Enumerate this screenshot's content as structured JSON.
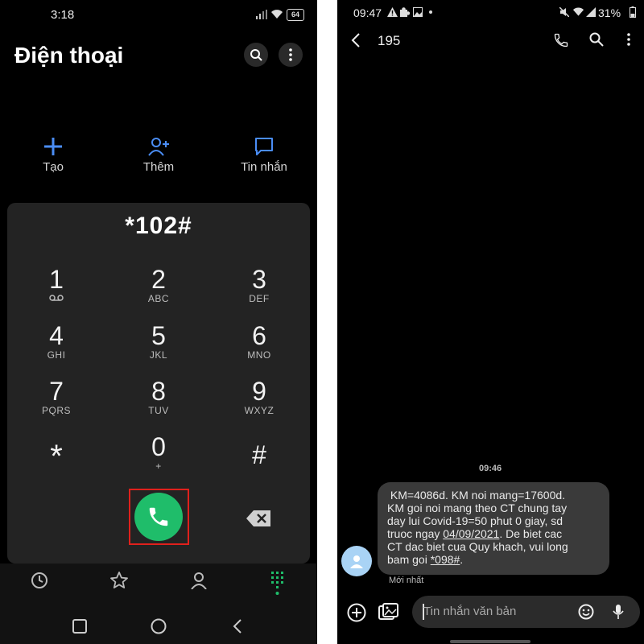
{
  "left": {
    "status": {
      "time": "3:18",
      "battery": "64"
    },
    "title": "Điện thoại",
    "actions": [
      {
        "label": "Tạo",
        "icon": "plus-icon"
      },
      {
        "label": "Thêm",
        "icon": "add-person-icon"
      },
      {
        "label": "Tin nhắn",
        "icon": "message-icon"
      }
    ],
    "dial_input": "*102#",
    "keys": [
      {
        "digit": "1",
        "letters": ""
      },
      {
        "digit": "2",
        "letters": "ABC"
      },
      {
        "digit": "3",
        "letters": "DEF"
      },
      {
        "digit": "4",
        "letters": "GHI"
      },
      {
        "digit": "5",
        "letters": "JKL"
      },
      {
        "digit": "6",
        "letters": "MNO"
      },
      {
        "digit": "7",
        "letters": "PQRS"
      },
      {
        "digit": "8",
        "letters": "TUV"
      },
      {
        "digit": "9",
        "letters": "WXYZ"
      },
      {
        "digit": "*",
        "letters": ""
      },
      {
        "digit": "0",
        "letters": "+"
      },
      {
        "digit": "#",
        "letters": ""
      }
    ],
    "colors": {
      "call_green": "#1fbd6a",
      "highlight_red": "#e0201c",
      "accent_blue": "#4a8df5",
      "active_green": "#1fbd6a"
    }
  },
  "right": {
    "status": {
      "time": "09:47",
      "battery": "31%"
    },
    "contact": "195",
    "message_time": "09:46",
    "message": {
      "line1": " KM=4086d. KM noi mang=17600d.",
      "line2": "KM goi noi mang theo CT chung tay",
      "line3": "day lui Covid-19=50 phut 0 giay, sd",
      "line4a": "truoc ngay ",
      "date_link": "04/09/2021",
      "line4b": ". De biet cac",
      "line5": "CT dac biet cua Quy khach, vui long",
      "line6a": "bam goi ",
      "code_link": "*098#",
      "line6b": "."
    },
    "latest_label": "Mới nhất",
    "input_placeholder": "Tin nhắn văn bản"
  }
}
